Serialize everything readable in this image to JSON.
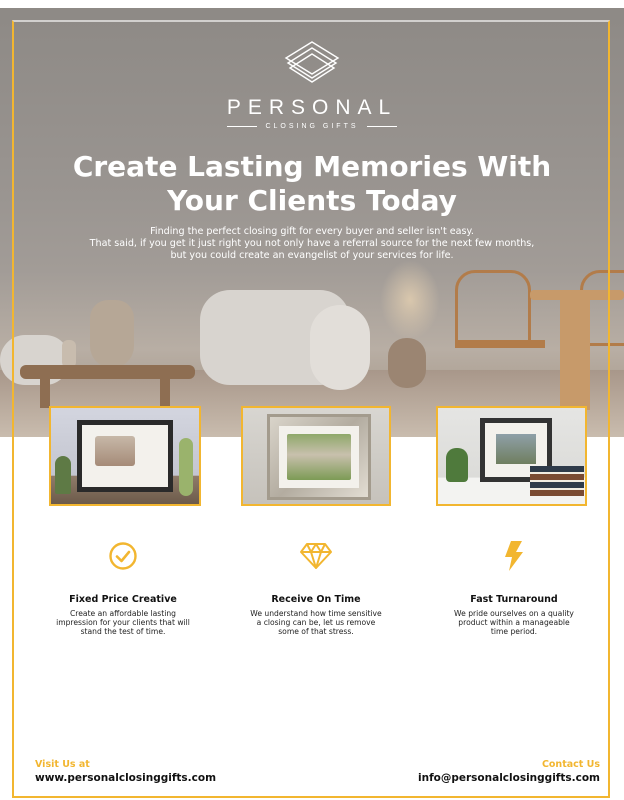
{
  "brand": {
    "name": "PERSONAL",
    "tagline": "CLOSING GIFTS",
    "accent_color": "#f2b630"
  },
  "hero": {
    "headline_line1": "Create Lasting Memories With",
    "headline_line2": "Your Clients Today",
    "intro_line1": "Finding the perfect closing gift for every buyer and seller isn't easy.",
    "intro_line2": "That said, if you get it just right you not only have a referral source for the next few months,",
    "intro_line3": "but you could create an evangelist of your services for life."
  },
  "photos": [
    {
      "name": "framed-house-painting-mantel"
    },
    {
      "name": "framed-house-painting-silver"
    },
    {
      "name": "framed-house-painting-books"
    }
  ],
  "features": [
    {
      "icon": "check-circle-icon",
      "title": "Fixed Price Creative",
      "desc1": "Create an affordable lasting",
      "desc2": "impression for your clients that will",
      "desc3": "stand the test of time."
    },
    {
      "icon": "diamond-icon",
      "title": "Receive On Time",
      "desc1": "We understand how time sensitive",
      "desc2": "a closing can be, let us remove",
      "desc3": "some of that stress."
    },
    {
      "icon": "lightning-bolt-icon",
      "title": "Fast Turnaround",
      "desc1": "We pride ourselves on a quality",
      "desc2": "product within a manageable",
      "desc3": "time period."
    }
  ],
  "footer": {
    "visit_label": "Visit Us at",
    "website": "www.personalclosinggifts.com",
    "contact_label": "Contact Us",
    "email": "info@personalclosinggifts.com"
  }
}
